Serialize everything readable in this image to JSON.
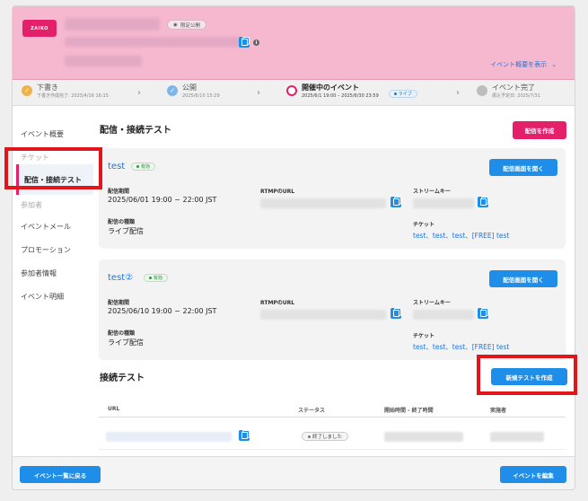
{
  "header": {
    "logo_text": "ZAIKO",
    "visibility_badge": "限定公開",
    "summary_link": "イベント概要を表示",
    "summary_chevron": "⌄"
  },
  "stepper": {
    "steps": [
      {
        "title": "下書き",
        "sub": "下書き作成完了: 2025/4/16 16:15",
        "state": "done"
      },
      {
        "title": "公開",
        "sub": "2025/6/10 15:29",
        "state": "done"
      },
      {
        "title": "開催中のイベント",
        "sub": "2025/6/1 19:00 – 2025/6/30 23:59",
        "state": "active",
        "badge": "ライブ"
      },
      {
        "title": "イベント完了",
        "sub": "振込予定日: 2025/7/31",
        "state": "pending"
      }
    ]
  },
  "sidebar": {
    "items": [
      {
        "label": "イベント概要"
      },
      {
        "label": "チケット"
      },
      {
        "label": "配信・接続テスト"
      },
      {
        "label": "参加者"
      },
      {
        "label": "イベントメール"
      },
      {
        "label": "プロモーション"
      },
      {
        "label": "参加者情報"
      },
      {
        "label": "イベント明細"
      }
    ]
  },
  "main": {
    "title": "配信・接続テスト",
    "create_button": "配信を作成",
    "streams": [
      {
        "name": "test",
        "status": "有効",
        "open_button": "配信画面を開く",
        "period_label": "配信期間",
        "period_value": "2025/06/01 19:00 ~ 22:00 JST",
        "type_label": "配信の種類",
        "type_value": "ライブ配信",
        "rtmp_label": "RTMPのURL",
        "key_label": "ストリームキー",
        "ticket_label": "チケット",
        "tickets": "test、test、test、[FREE] test"
      },
      {
        "name": "test②",
        "status": "有効",
        "open_button": "配信画面を開く",
        "period_label": "配信期間",
        "period_value": "2025/06/10 19:00 ~ 22:00 JST",
        "type_label": "配信の種類",
        "type_value": "ライブ配信",
        "rtmp_label": "RTMPのURL",
        "key_label": "ストリームキー",
        "ticket_label": "チケット",
        "tickets": "test、test、test、[FREE] test"
      }
    ],
    "connection": {
      "title": "接続テスト",
      "new_button": "新規テストを作成",
      "columns": [
        "URL",
        "ステータス",
        "開始時間 - 終了時間",
        "実施者"
      ],
      "rows": [
        {
          "status": "終了しました"
        }
      ]
    }
  },
  "footer": {
    "back_button": "イベント一覧に戻る",
    "edit_button": "イベントを編集"
  },
  "colors": {
    "accent_pink": "#e5206a",
    "primary_blue": "#1f8ee9",
    "header_bg": "#f6b8cf",
    "highlight_red": "#e0161b"
  }
}
